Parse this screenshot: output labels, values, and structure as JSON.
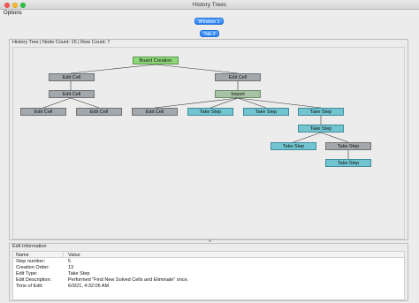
{
  "window": {
    "title": "History Trees"
  },
  "menu": {
    "options_label": "Options"
  },
  "tabs": {
    "window_tab": "Window 1",
    "inner_tab": "Tab 2"
  },
  "tree": {
    "header": "History Tree | Node Count: 15 | Row Count: 7",
    "nodes": {
      "n1": "Board Creation",
      "n2": "Edit Cell",
      "n3": "Edit Cell",
      "n4": "Edit Cell",
      "n5": "Import",
      "n6": "Edit Cell",
      "n7": "Edit Cell",
      "n8": "Edit Cell",
      "n9": "Take Step",
      "n10": "Take Step",
      "n11": "Take Step",
      "n12": "Take Step",
      "n13": "Take Step",
      "n14": "Take Step",
      "n15": "Take Step"
    }
  },
  "info": {
    "header": "Edit Information",
    "columns": [
      "Name",
      "Value"
    ],
    "rows": [
      {
        "name": "Step number:",
        "value": "5"
      },
      {
        "name": "Creation Order:",
        "value": "13"
      },
      {
        "name": "Edit Type:",
        "value": "Take Step"
      },
      {
        "name": "Edit Description:",
        "value": "Performed \"Find New Solved Cells and Eliminate\" once."
      },
      {
        "name": "Time of Edit:",
        "value": "6/3/21, 4:32:05 AM"
      }
    ]
  }
}
